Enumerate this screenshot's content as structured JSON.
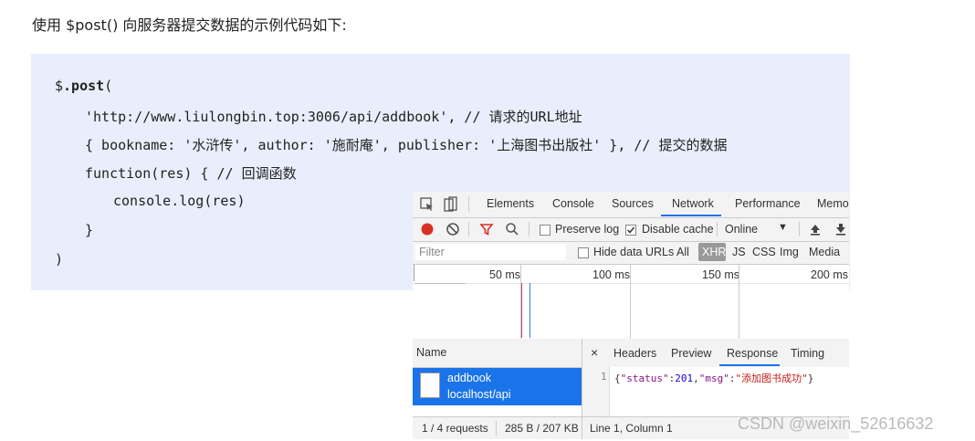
{
  "intro": "使用 $post() 向服务器提交数据的示例代码如下:",
  "code": {
    "line1_obj": "$",
    "line1_method": ".post",
    "line1_paren": "(",
    "line2": "'http://www.liulongbin.top:3006/api/addbook', // 请求的URL地址",
    "line3": "{ bookname: '水浒传', author: '施耐庵', publisher: '上海图书出版社' }, // 提交的数据",
    "line4": "function(res) { // 回调函数",
    "line5": "console.log(res)",
    "line6": "}",
    "line7": ")"
  },
  "devtools": {
    "tabs": [
      "Elements",
      "Console",
      "Sources",
      "Network",
      "Performance",
      "Memo"
    ],
    "active_tab": "Network",
    "toolbar": {
      "preserve_log": "Preserve log",
      "disable_cache": "Disable cache",
      "throttle": "Online"
    },
    "filter": {
      "placeholder": "Filter",
      "hide_data_urls": "Hide data URLs",
      "types": [
        "All",
        "XHR",
        "JS",
        "CSS",
        "Img",
        "Media"
      ]
    },
    "timeline_ticks": [
      "50 ms",
      "100 ms",
      "150 ms",
      "200 ms"
    ],
    "name_header": "Name",
    "detail_tabs": [
      "Headers",
      "Preview",
      "Response",
      "Timing"
    ],
    "active_detail_tab": "Response",
    "request": {
      "name": "addbook",
      "path": "localhost/api"
    },
    "response": {
      "line_no": "1",
      "brace_open": "{",
      "k1": "\"status\"",
      "colon1": ":",
      "v1": "201",
      "comma": ",",
      "k2": "\"msg\"",
      "colon2": ":",
      "v2": "\"添加图书成功\"",
      "brace_close": "}"
    },
    "status": {
      "requests": "1 / 4 requests",
      "size": "285 B / 207 KB",
      "position": "Line 1, Column 1"
    }
  },
  "watermark": "CSDN @weixin_52616632",
  "colors": {
    "code_bg": "#e8eefb",
    "accent": "#1a73e8",
    "selected": "#1a73e8"
  }
}
